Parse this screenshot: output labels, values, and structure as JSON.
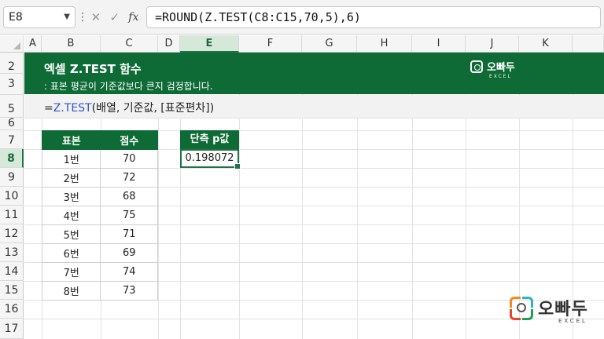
{
  "formula_bar": {
    "name_box": "E8",
    "kebab": "⋮",
    "cancel_icon": "✕",
    "enter_icon": "✓",
    "fx_label": "fx",
    "formula": "=ROUND(Z.TEST(C8:C15,70,5),6)"
  },
  "columns": [
    "A",
    "B",
    "C",
    "D",
    "E",
    "F",
    "G",
    "H",
    "I",
    "J",
    "K"
  ],
  "rows": [
    "2",
    "3",
    "5",
    "6",
    "7",
    "8",
    "9",
    "10",
    "11",
    "12",
    "13",
    "14",
    "15",
    "16",
    "17"
  ],
  "selected_row": "8",
  "banner": {
    "title": "엑셀 Z.TEST 함수",
    "subtitle": ": 표본 평균이 기준값보다 큰지 검정합니다.",
    "logo_name": "오빠두",
    "logo_sub": "EXCEL",
    "color": "#0e6b36"
  },
  "syntax": {
    "eq": "=",
    "fn": "Z.TEST",
    "args": "(배열, 기준값, [표준편차])",
    "fn_color": "#2f54c9"
  },
  "table": {
    "headers": [
      "표본",
      "점수"
    ],
    "rows": [
      [
        "1번",
        "70"
      ],
      [
        "2번",
        "72"
      ],
      [
        "3번",
        "68"
      ],
      [
        "4번",
        "75"
      ],
      [
        "5번",
        "71"
      ],
      [
        "6번",
        "69"
      ],
      [
        "7번",
        "74"
      ],
      [
        "8번",
        "73"
      ]
    ]
  },
  "result": {
    "header": "단측 p값",
    "value": "0.198072"
  },
  "watermark": {
    "name": "오빠두",
    "sub": "EXCEL"
  }
}
